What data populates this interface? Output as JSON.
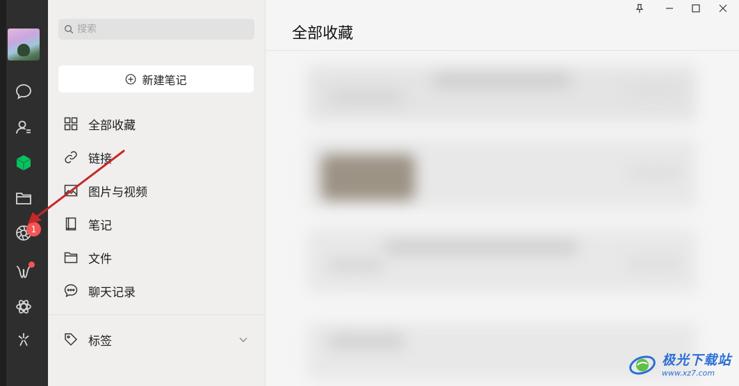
{
  "sidebar": {
    "avatar_label": "",
    "badge_count": "1",
    "icons": [
      "chat-icon",
      "contacts-icon",
      "favorites-cube-icon",
      "folder-icon",
      "moments-icon",
      "channels-icon",
      "mini-programs-icon",
      "search-sparkle-icon"
    ]
  },
  "panel": {
    "search_placeholder": "搜索",
    "new_note_label": "新建笔记",
    "menu": [
      {
        "label": "全部收藏",
        "icon": "grid-icon"
      },
      {
        "label": "链接",
        "icon": "link-icon"
      },
      {
        "label": "图片与视频",
        "icon": "image-icon"
      },
      {
        "label": "笔记",
        "icon": "notebook-icon"
      },
      {
        "label": "文件",
        "icon": "folder-icon"
      },
      {
        "label": "聊天记录",
        "icon": "chat-bubble-icon"
      }
    ],
    "tags_label": "标签"
  },
  "main": {
    "title": "全部收藏"
  },
  "watermark": {
    "name": "极光下载站",
    "url": "www.xz7.com"
  },
  "colors": {
    "rail": "#2e2e2e",
    "accent": "#07c160",
    "badge": "#f15555",
    "annotation_arrow": "#c62828",
    "watermark": "#2a6fd6"
  }
}
